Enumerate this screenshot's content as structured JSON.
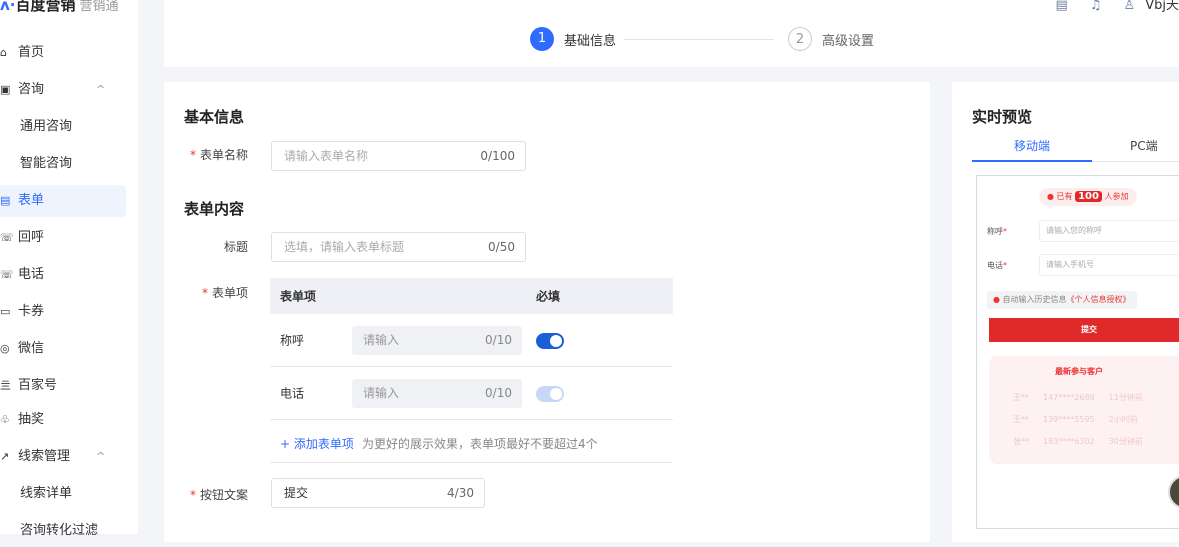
{
  "brand": {
    "name": "百度营销",
    "product": "营销通"
  },
  "sidebar": {
    "items": [
      {
        "label": "首页",
        "icon": "⌂"
      },
      {
        "label": "咨询",
        "icon": "▣",
        "chev": "^"
      },
      {
        "label": "通用咨询"
      },
      {
        "label": "智能咨询"
      },
      {
        "label": "表单",
        "icon": "▤"
      },
      {
        "label": "回呼",
        "icon": "☏"
      },
      {
        "label": "电话",
        "icon": "☏"
      },
      {
        "label": "卡券",
        "icon": "▭"
      },
      {
        "label": "微信",
        "icon": "◎"
      },
      {
        "label": "百家号",
        "icon": "亖"
      },
      {
        "label": "抽奖",
        "icon": "♧"
      },
      {
        "label": "线索管理",
        "icon": "↗",
        "chev": "^"
      },
      {
        "label": "线索详单"
      },
      {
        "label": "咨询转化过滤"
      }
    ]
  },
  "topbar": {
    "user": "Vbj天"
  },
  "steps": [
    {
      "num": "1",
      "label": "基础信息"
    },
    {
      "num": "2",
      "label": "高级设置"
    }
  ],
  "form": {
    "section1": "基本信息",
    "name_label": "表单名称",
    "name_placeholder": "请输入表单名称",
    "name_count": "0/100",
    "section2": "表单内容",
    "title_label": "标题",
    "title_placeholder": "选填，请输入表单标题",
    "title_count": "0/50",
    "items_label": "表单项",
    "table": {
      "col1": "表单项",
      "col2": "必填",
      "rows": [
        {
          "name": "称呼",
          "placeholder": "请输入",
          "count": "0/10",
          "required": true
        },
        {
          "name": "电话",
          "placeholder": "请输入",
          "count": "0/10",
          "required": true
        }
      ]
    },
    "add_item": "+ 添加表单项",
    "add_hint": "为更好的展示效果，表单项最好不要超过4个",
    "button_label": "按钮文案",
    "button_value": "提交",
    "button_count": "4/30"
  },
  "preview": {
    "title": "实时预览",
    "tabs": [
      "移动端",
      "PC端"
    ],
    "badge_pre": "已有",
    "badge_num": "100",
    "badge_post": "人参加",
    "field1": "称呼",
    "field1_ph": "请输入您的称呼",
    "field2": "电话",
    "field2_ph": "请输入手机号",
    "auto_fill": "自动输入历史信息",
    "privacy": "《个人信息授权》",
    "submit": "提交",
    "recent_title": "最新参与客户",
    "recent": [
      {
        "name": "王**",
        "phone": "147****2689",
        "time": "11分钟前"
      },
      {
        "name": "王**",
        "phone": "139****5595",
        "time": "2小时前"
      },
      {
        "name": "张**",
        "phone": "183****6302",
        "time": "30分钟前"
      }
    ]
  }
}
